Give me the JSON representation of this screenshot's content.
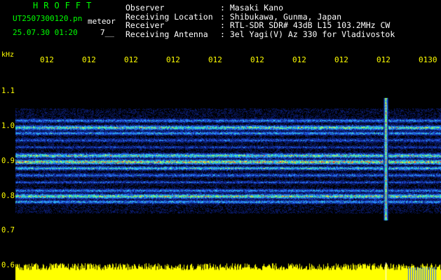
{
  "header": {
    "app_title": "HROFFT",
    "file_name": "UT2507300120.pn",
    "event_type": "meteor",
    "date_time": "25.07.30 01:20",
    "code": "7__"
  },
  "info": {
    "rows": [
      {
        "label": "Observer",
        "value": ": Masaki Kano"
      },
      {
        "label": "Receiving Location",
        "value": ": Shibukawa, Gunma, Japan"
      },
      {
        "label": "Receiver",
        "value": ": RTL-SDR SDR# 43dB L15 103.2MHz CW"
      },
      {
        "label": "Receiving Antenna",
        "value": ": 3el Yagi(V) Az 330 for Vladivostok"
      }
    ]
  },
  "axis": {
    "y_unit": "kHz",
    "x_ticks": [
      "012",
      "012",
      "012",
      "012",
      "012",
      "012",
      "012",
      "012",
      "012",
      "0130"
    ],
    "y_ticks": [
      "1.1",
      "1.0",
      "0.9",
      "0.8",
      "0.7",
      "0.6"
    ]
  },
  "colors": {
    "text_header": "#00ff00",
    "text_info": "#ffffff",
    "text_axis": "#ffff00",
    "background": "#000000"
  }
}
